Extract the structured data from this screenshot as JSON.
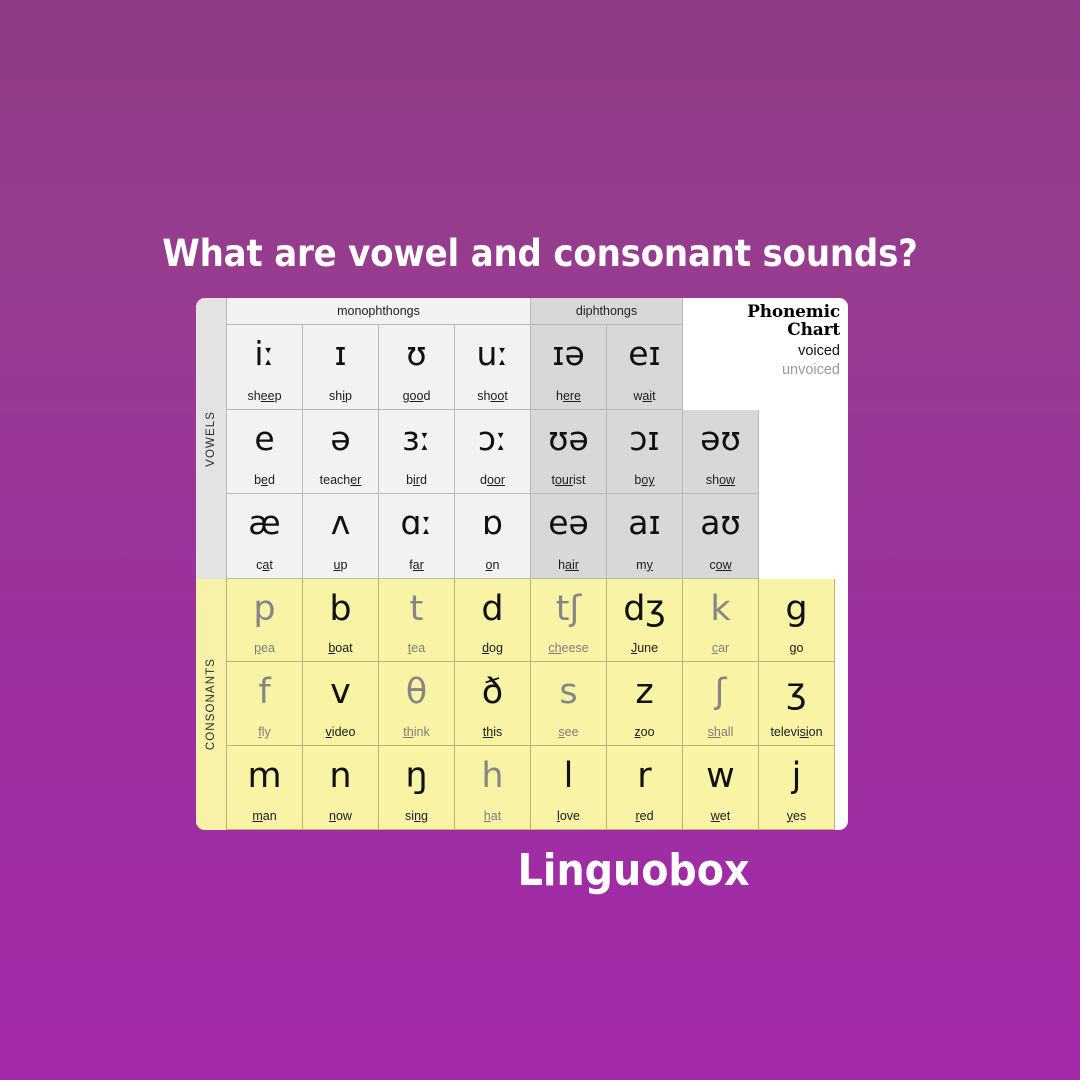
{
  "title": "What are vowel and consonant sounds?",
  "brand": "Linguobox",
  "colors": {
    "background_top": "#8f3a85",
    "background_bottom": "#a32aa9",
    "vowel_cell": "#f2f2f2",
    "diphthong_cell": "#d8d8d8",
    "consonant_cell": "#f9f3a6",
    "voiced_text": "#111111",
    "unvoiced_text": "#868686"
  },
  "chart": {
    "legend": {
      "title_line1": "Phonemic",
      "title_line2": "Chart",
      "voiced": "voiced",
      "unvoiced": "unvoiced"
    },
    "headers": {
      "monophthongs": "monophthongs",
      "diphthongs": "diphthongs"
    },
    "side_labels": {
      "vowels": "VOWELS",
      "consonants": "CONSONANTS"
    },
    "vowel_rows": [
      [
        {
          "symbol": "iː",
          "word": "sh",
          "underline": "ee",
          "word_end": "p",
          "voiced": true,
          "group": "mono"
        },
        {
          "symbol": "ɪ",
          "word": "sh",
          "underline": "i",
          "word_end": "p",
          "voiced": true,
          "group": "mono"
        },
        {
          "symbol": "ʊ",
          "word": "g",
          "underline": "oo",
          "word_end": "d",
          "voiced": true,
          "group": "mono"
        },
        {
          "symbol": "uː",
          "word": "sh",
          "underline": "oo",
          "word_end": "t",
          "voiced": true,
          "group": "mono"
        },
        {
          "symbol": "ɪə",
          "word": "h",
          "underline": "ere",
          "word_end": "",
          "voiced": true,
          "group": "diph"
        },
        {
          "symbol": "eɪ",
          "word": "w",
          "underline": "ai",
          "word_end": "t",
          "voiced": true,
          "group": "diph"
        },
        {
          "symbol": "",
          "word": "",
          "underline": "",
          "word_end": "",
          "voiced": true,
          "group": "blank"
        },
        {
          "symbol": "",
          "word": "",
          "underline": "",
          "word_end": "",
          "voiced": true,
          "group": "blank"
        }
      ],
      [
        {
          "symbol": "e",
          "word": "b",
          "underline": "e",
          "word_end": "d",
          "voiced": true,
          "group": "mono"
        },
        {
          "symbol": "ə",
          "word": "teach",
          "underline": "er",
          "word_end": "",
          "voiced": true,
          "group": "mono"
        },
        {
          "symbol": "ɜː",
          "word": "b",
          "underline": "ir",
          "word_end": "d",
          "voiced": true,
          "group": "mono"
        },
        {
          "symbol": "ɔː",
          "word": "d",
          "underline": "oor",
          "word_end": "",
          "voiced": true,
          "group": "mono"
        },
        {
          "symbol": "ʊə",
          "word": "t",
          "underline": "our",
          "word_end": "ist",
          "voiced": true,
          "group": "diph"
        },
        {
          "symbol": "ɔɪ",
          "word": "b",
          "underline": "oy",
          "word_end": "",
          "voiced": true,
          "group": "diph"
        },
        {
          "symbol": "əʊ",
          "word": "sh",
          "underline": "ow",
          "word_end": "",
          "voiced": true,
          "group": "diph"
        },
        {
          "symbol": "",
          "word": "",
          "underline": "",
          "word_end": "",
          "voiced": true,
          "group": "blank"
        }
      ],
      [
        {
          "symbol": "æ",
          "word": "c",
          "underline": "a",
          "word_end": "t",
          "voiced": true,
          "group": "mono"
        },
        {
          "symbol": "ʌ",
          "word": "",
          "underline": "u",
          "word_end": "p",
          "voiced": true,
          "group": "mono"
        },
        {
          "symbol": "ɑː",
          "word": "f",
          "underline": "ar",
          "word_end": "",
          "voiced": true,
          "group": "mono"
        },
        {
          "symbol": "ɒ",
          "word": "",
          "underline": "o",
          "word_end": "n",
          "voiced": true,
          "group": "mono"
        },
        {
          "symbol": "eə",
          "word": "h",
          "underline": "air",
          "word_end": "",
          "voiced": true,
          "group": "diph"
        },
        {
          "symbol": "aɪ",
          "word": "m",
          "underline": "y",
          "word_end": "",
          "voiced": true,
          "group": "diph"
        },
        {
          "symbol": "aʊ",
          "word": "c",
          "underline": "ow",
          "word_end": "",
          "voiced": true,
          "group": "diph"
        },
        {
          "symbol": "",
          "word": "",
          "underline": "",
          "word_end": "",
          "voiced": true,
          "group": "blank"
        }
      ]
    ],
    "consonant_rows": [
      [
        {
          "symbol": "p",
          "word": "",
          "underline": "p",
          "word_end": "ea",
          "voiced": false
        },
        {
          "symbol": "b",
          "word": "",
          "underline": "b",
          "word_end": "oat",
          "voiced": true
        },
        {
          "symbol": "t",
          "word": "",
          "underline": "t",
          "word_end": "ea",
          "voiced": false
        },
        {
          "symbol": "d",
          "word": "",
          "underline": "d",
          "word_end": "og",
          "voiced": true
        },
        {
          "symbol": "tʃ",
          "word": "",
          "underline": "ch",
          "word_end": "eese",
          "voiced": false
        },
        {
          "symbol": "dʒ",
          "word": "",
          "underline": "J",
          "word_end": "une",
          "voiced": true
        },
        {
          "symbol": "k",
          "word": "",
          "underline": "c",
          "word_end": "ar",
          "voiced": false
        },
        {
          "symbol": "g",
          "word": "",
          "underline": "g",
          "word_end": "o",
          "voiced": true
        }
      ],
      [
        {
          "symbol": "f",
          "word": "",
          "underline": "f",
          "word_end": "ly",
          "voiced": false
        },
        {
          "symbol": "v",
          "word": "",
          "underline": "v",
          "word_end": "ideo",
          "voiced": true
        },
        {
          "symbol": "θ",
          "word": "",
          "underline": "th",
          "word_end": "ink",
          "voiced": false
        },
        {
          "symbol": "ð",
          "word": "",
          "underline": "th",
          "word_end": "is",
          "voiced": true
        },
        {
          "symbol": "s",
          "word": "",
          "underline": "s",
          "word_end": "ee",
          "voiced": false
        },
        {
          "symbol": "z",
          "word": "",
          "underline": "z",
          "word_end": "oo",
          "voiced": true
        },
        {
          "symbol": "ʃ",
          "word": "",
          "underline": "sh",
          "word_end": "all",
          "voiced": false
        },
        {
          "symbol": "ʒ",
          "word": "televi",
          "underline": "si",
          "word_end": "on",
          "voiced": true
        }
      ],
      [
        {
          "symbol": "m",
          "word": "",
          "underline": "m",
          "word_end": "an",
          "voiced": true
        },
        {
          "symbol": "n",
          "word": "",
          "underline": "n",
          "word_end": "ow",
          "voiced": true
        },
        {
          "symbol": "ŋ",
          "word": "si",
          "underline": "ng",
          "word_end": "",
          "voiced": true
        },
        {
          "symbol": "h",
          "word": "",
          "underline": "h",
          "word_end": "at",
          "voiced": false
        },
        {
          "symbol": "l",
          "word": "",
          "underline": "l",
          "word_end": "ove",
          "voiced": true
        },
        {
          "symbol": "r",
          "word": "",
          "underline": "r",
          "word_end": "ed",
          "voiced": true
        },
        {
          "symbol": "w",
          "word": "",
          "underline": "w",
          "word_end": "et",
          "voiced": true
        },
        {
          "symbol": "j",
          "word": "",
          "underline": "y",
          "word_end": "es",
          "voiced": true
        }
      ]
    ]
  }
}
